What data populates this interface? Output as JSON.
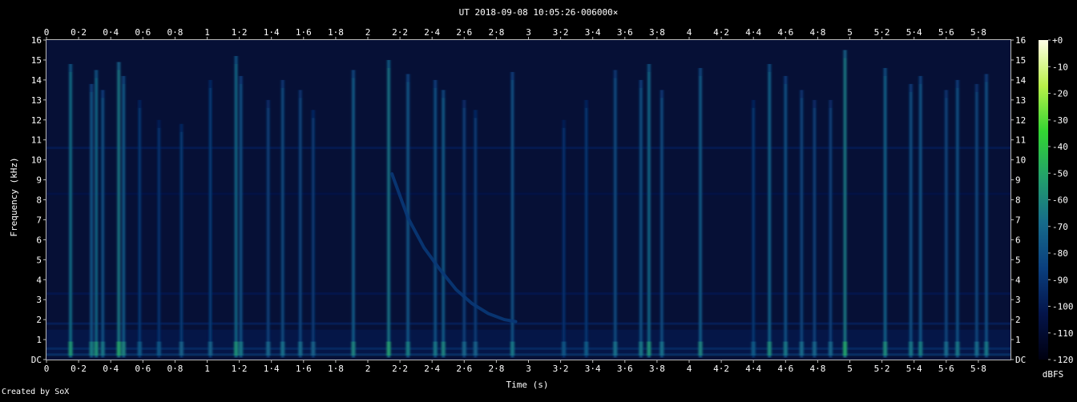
{
  "chart_data": {
    "type": "heatmap",
    "title": "UT 2018-09-08 10:05:26·006000×",
    "xlabel": "Time (s)",
    "ylabel": "Frequency (kHz)",
    "xlim": [
      0,
      6.0
    ],
    "ylim": [
      0,
      16
    ],
    "x_ticks": [
      {
        "value": 0,
        "label": "0"
      },
      {
        "value": 0.2,
        "label": "0·2"
      },
      {
        "value": 0.4,
        "label": "0·4"
      },
      {
        "value": 0.6,
        "label": "0·6"
      },
      {
        "value": 0.8,
        "label": "0·8"
      },
      {
        "value": 1.0,
        "label": "1"
      },
      {
        "value": 1.2,
        "label": "1·2"
      },
      {
        "value": 1.4,
        "label": "1·4"
      },
      {
        "value": 1.6,
        "label": "1·6"
      },
      {
        "value": 1.8,
        "label": "1·8"
      },
      {
        "value": 2.0,
        "label": "2"
      },
      {
        "value": 2.2,
        "label": "2·2"
      },
      {
        "value": 2.4,
        "label": "2·4"
      },
      {
        "value": 2.6,
        "label": "2·6"
      },
      {
        "value": 2.8,
        "label": "2·8"
      },
      {
        "value": 3.0,
        "label": "3"
      },
      {
        "value": 3.2,
        "label": "3·2"
      },
      {
        "value": 3.4,
        "label": "3·4"
      },
      {
        "value": 3.6,
        "label": "3·6"
      },
      {
        "value": 3.8,
        "label": "3·8"
      },
      {
        "value": 4.0,
        "label": "4"
      },
      {
        "value": 4.2,
        "label": "4·2"
      },
      {
        "value": 4.4,
        "label": "4·4"
      },
      {
        "value": 4.6,
        "label": "4·6"
      },
      {
        "value": 4.8,
        "label": "4·8"
      },
      {
        "value": 5.0,
        "label": "5"
      },
      {
        "value": 5.2,
        "label": "5·2"
      },
      {
        "value": 5.4,
        "label": "5·4"
      },
      {
        "value": 5.6,
        "label": "5·6"
      },
      {
        "value": 5.8,
        "label": "5·8"
      }
    ],
    "y_ticks": [
      {
        "value": 0,
        "label": "DC"
      },
      {
        "value": 1,
        "label": "1"
      },
      {
        "value": 2,
        "label": "2"
      },
      {
        "value": 3,
        "label": "3"
      },
      {
        "value": 4,
        "label": "4"
      },
      {
        "value": 5,
        "label": "5"
      },
      {
        "value": 6,
        "label": "6"
      },
      {
        "value": 7,
        "label": "7"
      },
      {
        "value": 8,
        "label": "8"
      },
      {
        "value": 9,
        "label": "9"
      },
      {
        "value": 10,
        "label": "10"
      },
      {
        "value": 11,
        "label": "11"
      },
      {
        "value": 12,
        "label": "12"
      },
      {
        "value": 13,
        "label": "13"
      },
      {
        "value": 14,
        "label": "14"
      },
      {
        "value": 15,
        "label": "15"
      },
      {
        "value": 16,
        "label": "16"
      }
    ],
    "colorbar": {
      "label": "dBFS",
      "range": [
        -120,
        0
      ],
      "ticks": [
        {
          "value": 0,
          "label": "+0"
        },
        {
          "value": -10,
          "label": "-10"
        },
        {
          "value": -20,
          "label": "-20"
        },
        {
          "value": -30,
          "label": "-30"
        },
        {
          "value": -40,
          "label": "-40"
        },
        {
          "value": -50,
          "label": "-50"
        },
        {
          "value": -60,
          "label": "-60"
        },
        {
          "value": -70,
          "label": "-70"
        },
        {
          "value": -80,
          "label": "-80"
        },
        {
          "value": -90,
          "label": "-90"
        },
        {
          "value": -100,
          "label": "-100"
        },
        {
          "value": -110,
          "label": "-110"
        },
        {
          "value": -120,
          "label": "-120"
        }
      ],
      "colors": [
        "#000010",
        "#04144a",
        "#0a3f7e",
        "#166b8a",
        "#22a06a",
        "#33d632",
        "#b9f04a",
        "#ffffe6"
      ]
    },
    "background_color": "#061036",
    "events": [
      {
        "t": 0.15,
        "f_top": 14.8,
        "level": -70
      },
      {
        "t": 0.28,
        "f_top": 13.8,
        "level": -78
      },
      {
        "t": 0.31,
        "f_top": 14.5,
        "level": -72
      },
      {
        "t": 0.35,
        "f_top": 13.5,
        "level": -80
      },
      {
        "t": 0.45,
        "f_top": 14.9,
        "level": -66
      },
      {
        "t": 0.48,
        "f_top": 14.2,
        "level": -76
      },
      {
        "t": 0.58,
        "f_top": 13.0,
        "level": -90
      },
      {
        "t": 0.7,
        "f_top": 12.0,
        "level": -92
      },
      {
        "t": 0.84,
        "f_top": 11.8,
        "level": -88
      },
      {
        "t": 1.02,
        "f_top": 14.0,
        "level": -88
      },
      {
        "t": 1.18,
        "f_top": 15.2,
        "level": -72
      },
      {
        "t": 1.21,
        "f_top": 14.2,
        "level": -80
      },
      {
        "t": 1.38,
        "f_top": 13.0,
        "level": -86
      },
      {
        "t": 1.47,
        "f_top": 14.0,
        "level": -82
      },
      {
        "t": 1.58,
        "f_top": 13.5,
        "level": -84
      },
      {
        "t": 1.66,
        "f_top": 12.5,
        "level": -88
      },
      {
        "t": 1.91,
        "f_top": 14.5,
        "level": -76
      },
      {
        "t": 2.13,
        "f_top": 15.0,
        "level": -68
      },
      {
        "t": 2.25,
        "f_top": 14.3,
        "level": -78
      },
      {
        "t": 2.42,
        "f_top": 14.0,
        "level": -80
      },
      {
        "t": 2.47,
        "f_top": 13.5,
        "level": -76
      },
      {
        "t": 2.6,
        "f_top": 13.0,
        "level": -86
      },
      {
        "t": 2.67,
        "f_top": 12.5,
        "level": -88
      },
      {
        "t": 2.9,
        "f_top": 14.4,
        "level": -80
      },
      {
        "t": 3.22,
        "f_top": 12.0,
        "level": -92
      },
      {
        "t": 3.36,
        "f_top": 13.0,
        "level": -90
      },
      {
        "t": 3.54,
        "f_top": 14.5,
        "level": -82
      },
      {
        "t": 3.7,
        "f_top": 14.0,
        "level": -80
      },
      {
        "t": 3.75,
        "f_top": 14.8,
        "level": -72
      },
      {
        "t": 3.83,
        "f_top": 13.5,
        "level": -82
      },
      {
        "t": 4.07,
        "f_top": 14.6,
        "level": -76
      },
      {
        "t": 4.4,
        "f_top": 13.0,
        "level": -90
      },
      {
        "t": 4.5,
        "f_top": 14.8,
        "level": -74
      },
      {
        "t": 4.6,
        "f_top": 14.2,
        "level": -80
      },
      {
        "t": 4.7,
        "f_top": 13.5,
        "level": -84
      },
      {
        "t": 4.78,
        "f_top": 13.0,
        "level": -86
      },
      {
        "t": 4.88,
        "f_top": 13.0,
        "level": -86
      },
      {
        "t": 4.97,
        "f_top": 15.5,
        "level": -66
      },
      {
        "t": 5.22,
        "f_top": 14.6,
        "level": -74
      },
      {
        "t": 5.38,
        "f_top": 13.8,
        "level": -80
      },
      {
        "t": 5.44,
        "f_top": 14.2,
        "level": -78
      },
      {
        "t": 5.6,
        "f_top": 13.5,
        "level": -84
      },
      {
        "t": 5.67,
        "f_top": 14.0,
        "level": -80
      },
      {
        "t": 5.79,
        "f_top": 13.8,
        "level": -84
      },
      {
        "t": 5.85,
        "f_top": 14.3,
        "level": -80
      }
    ],
    "sweep": {
      "points": [
        [
          2.15,
          9.3
        ],
        [
          2.25,
          7.1
        ],
        [
          2.35,
          5.6
        ],
        [
          2.45,
          4.5
        ],
        [
          2.55,
          3.5
        ],
        [
          2.65,
          2.8
        ],
        [
          2.75,
          2.3
        ],
        [
          2.85,
          2.0
        ],
        [
          2.92,
          1.9
        ]
      ],
      "level": -88
    },
    "tones": [
      {
        "f": 0.25,
        "level": -78
      },
      {
        "f": 0.55,
        "level": -84
      },
      {
        "f": 1.8,
        "level": -98
      },
      {
        "f": 3.3,
        "level": -102
      },
      {
        "f": 8.3,
        "level": -104
      },
      {
        "f": 10.6,
        "level": -100
      }
    ]
  },
  "credit": "Created by SoX"
}
